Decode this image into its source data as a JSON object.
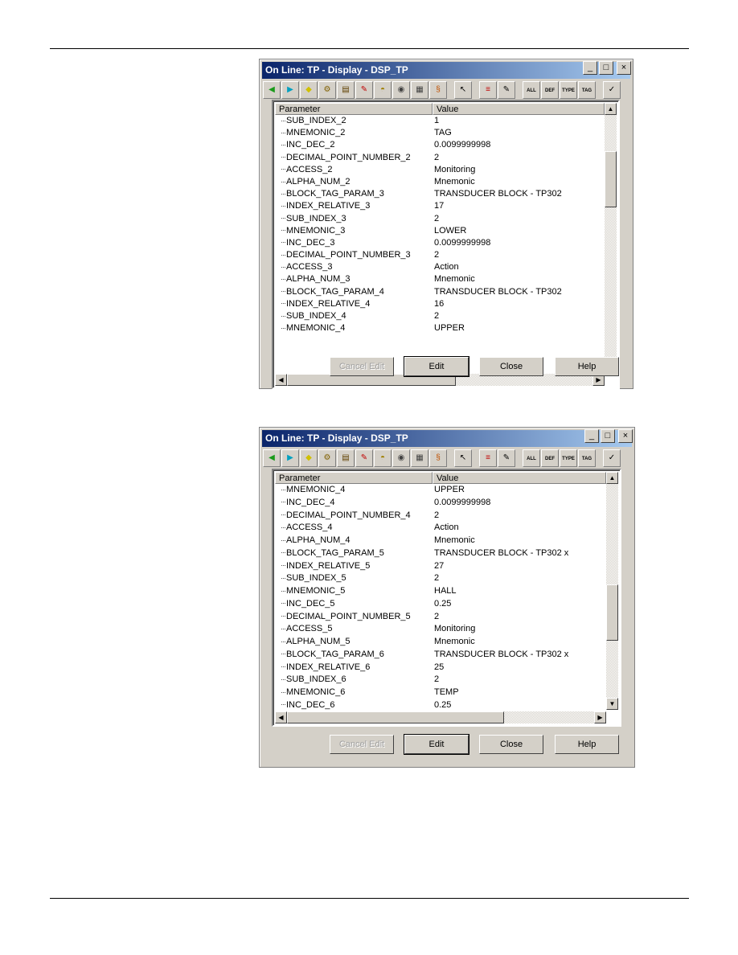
{
  "toolbar_icons": [
    {
      "name": "back-arrow-icon",
      "glyph": "◀",
      "color": "#1a9a1a"
    },
    {
      "name": "forward-arrow-icon",
      "glyph": "▶",
      "color": "#00a0c0"
    },
    {
      "name": "diamond-icon",
      "glyph": "◆",
      "color": "#d0c000"
    },
    {
      "name": "gears-icon",
      "glyph": "⚙",
      "color": "#806000"
    },
    {
      "name": "form-edit-icon",
      "glyph": "▤",
      "color": "#604000"
    },
    {
      "name": "wrench-icon",
      "glyph": "✎",
      "color": "#c00000"
    },
    {
      "name": "hill-icon",
      "glyph": "◓",
      "color": "#a08000"
    },
    {
      "name": "satellite-icon",
      "glyph": "◉",
      "color": "#404040"
    },
    {
      "name": "device-icon",
      "glyph": "▦",
      "color": "#404040"
    },
    {
      "name": "scroll-icon",
      "glyph": "§",
      "color": "#c05000"
    },
    {
      "name": "cursor-end-icon",
      "glyph": "↖",
      "color": "#000000"
    },
    {
      "name": "list-arrow-icon",
      "glyph": "≡",
      "color": "#c00000"
    },
    {
      "name": "pen-icon",
      "glyph": "✎",
      "color": "#000000"
    },
    {
      "name": "all-icon",
      "glyph": "ALL",
      "color": "#000000"
    },
    {
      "name": "def-icon",
      "glyph": "DEF",
      "color": "#000000"
    },
    {
      "name": "type-icon",
      "glyph": "TYPE",
      "color": "#000000"
    },
    {
      "name": "tag-icon",
      "glyph": "TAG",
      "color": "#000000"
    },
    {
      "name": "check-icon",
      "glyph": "✓",
      "color": "#000000"
    }
  ],
  "dialogs": [
    {
      "title": "On Line: TP - Display - DSP_TP",
      "columns": [
        "Parameter",
        "Value"
      ],
      "rows": [
        [
          "SUB_INDEX_2",
          "1"
        ],
        [
          "MNEMONIC_2",
          "TAG"
        ],
        [
          "INC_DEC_2",
          "0.0099999998"
        ],
        [
          "DECIMAL_POINT_NUMBER_2",
          "2"
        ],
        [
          "ACCESS_2",
          "Monitoring"
        ],
        [
          "ALPHA_NUM_2",
          "Mnemonic"
        ],
        [
          "BLOCK_TAG_PARAM_3",
          "TRANSDUCER BLOCK - TP302"
        ],
        [
          "INDEX_RELATIVE_3",
          "17"
        ],
        [
          "SUB_INDEX_3",
          "2"
        ],
        [
          "MNEMONIC_3",
          "LOWER"
        ],
        [
          "INC_DEC_3",
          "0.0099999998"
        ],
        [
          "DECIMAL_POINT_NUMBER_3",
          "2"
        ],
        [
          "ACCESS_3",
          "Action"
        ],
        [
          "ALPHA_NUM_3",
          "Mnemonic"
        ],
        [
          "BLOCK_TAG_PARAM_4",
          "TRANSDUCER BLOCK - TP302"
        ],
        [
          "INDEX_RELATIVE_4",
          "16"
        ],
        [
          "SUB_INDEX_4",
          "2"
        ],
        [
          "MNEMONIC_4",
          "UPPER"
        ]
      ],
      "buttons": [
        "Cancel Edit",
        "Edit",
        "Close",
        "Help"
      ]
    },
    {
      "title": "On Line: TP - Display - DSP_TP",
      "columns": [
        "Parameter",
        "Value"
      ],
      "rows": [
        [
          "MNEMONIC_4",
          "UPPER"
        ],
        [
          "INC_DEC_4",
          "0.0099999998"
        ],
        [
          "DECIMAL_POINT_NUMBER_4",
          "2"
        ],
        [
          "ACCESS_4",
          "Action"
        ],
        [
          "ALPHA_NUM_4",
          "Mnemonic"
        ],
        [
          "BLOCK_TAG_PARAM_5",
          "TRANSDUCER BLOCK - TP302  x"
        ],
        [
          "INDEX_RELATIVE_5",
          "27"
        ],
        [
          "SUB_INDEX_5",
          "2"
        ],
        [
          "MNEMONIC_5",
          "HALL"
        ],
        [
          "INC_DEC_5",
          "0.25"
        ],
        [
          "DECIMAL_POINT_NUMBER_5",
          "2"
        ],
        [
          "ACCESS_5",
          "Monitoring"
        ],
        [
          "ALPHA_NUM_5",
          "Mnemonic"
        ],
        [
          "BLOCK_TAG_PARAM_6",
          "TRANSDUCER BLOCK - TP302  x"
        ],
        [
          "INDEX_RELATIVE_6",
          "25"
        ],
        [
          "SUB_INDEX_6",
          "2"
        ],
        [
          "MNEMONIC_6",
          "TEMP"
        ],
        [
          "INC_DEC_6",
          "0.25"
        ]
      ],
      "buttons": [
        "Cancel Edit",
        "Edit",
        "Close",
        "Help"
      ]
    }
  ],
  "window_buttons": [
    "_",
    "□",
    "×"
  ]
}
